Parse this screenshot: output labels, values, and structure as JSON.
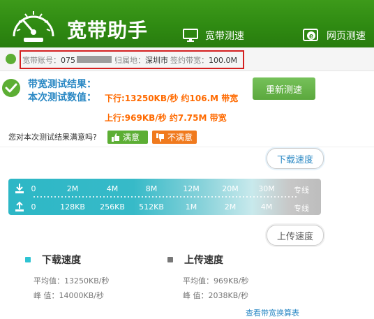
{
  "app": {
    "title": "宽带助手"
  },
  "nav": [
    {
      "label": "宽带测速",
      "icon": "monitor-icon"
    },
    {
      "label": "网页测速",
      "icon": "browser-e-icon"
    }
  ],
  "account": {
    "account_label": "宽带账号：",
    "account_value": "075",
    "location_label": "归属地：",
    "location_value": "深圳市",
    "bandwidth_label": "签约带宽：",
    "bandwidth_value": "100.0M"
  },
  "result": {
    "title": "带宽测试结果：",
    "subtitle": "本次测试数值：",
    "download_line": "下行:13250KB/秒 约106.M 带宽",
    "upload_line": "上行:969KB/秒 约7.75M 带宽",
    "retest_label": "重新测速"
  },
  "satisfaction": {
    "question": "您对本次测试结果满意吗?",
    "yes_label": "满意",
    "no_label": "不满意"
  },
  "speed_scale": {
    "download_bubble": "下载速度",
    "upload_bubble": "上传速度",
    "download_ticks": [
      "0",
      "2M",
      "4M",
      "8M",
      "12M",
      "20M",
      "30M",
      "专线"
    ],
    "upload_ticks": [
      "0",
      "128KB",
      "256KB",
      "512KB",
      "1M",
      "2M",
      "4M",
      "专线"
    ]
  },
  "stats": {
    "download": {
      "title": "下载速度",
      "avg_label": "平均值：",
      "avg_value": "13250KB/秒",
      "peak_label": "峰  值：",
      "peak_value": "14000KB/秒"
    },
    "upload": {
      "title": "上传速度",
      "avg_label": "平均值：",
      "avg_value": "969KB/秒",
      "peak_label": "峰  值：",
      "peak_value": "2038KB/秒"
    },
    "formula_link": "查看带宽换算表"
  },
  "colors": {
    "header_green": "#2f8a12",
    "accent_blue": "#2a88c4",
    "speed_orange": "#ff6a00",
    "highlight_red": "#d41f1f",
    "scale_teal": "#2db7c6"
  }
}
